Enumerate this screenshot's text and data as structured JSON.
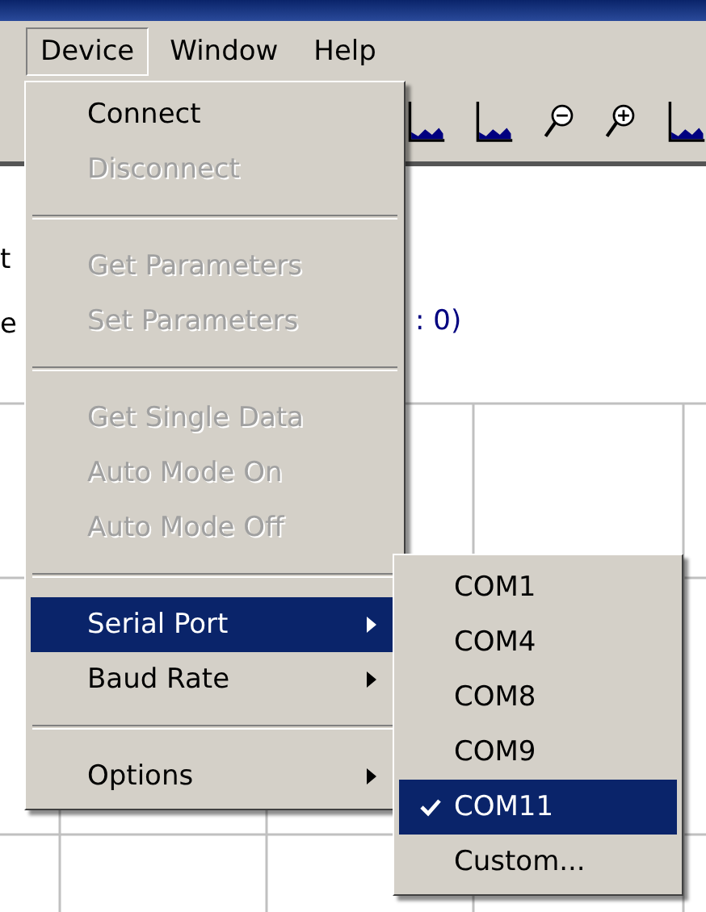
{
  "menubar": [
    {
      "label": "Device",
      "selected": true
    },
    {
      "label": "Window",
      "selected": false
    },
    {
      "label": "Help",
      "selected": false
    }
  ],
  "content": {
    "fragments": [
      "t",
      "e",
      ": 0)"
    ]
  },
  "menu": {
    "items": [
      {
        "kind": "item",
        "label": "Connect",
        "disabled": false,
        "selected": false
      },
      {
        "kind": "item",
        "label": "Disconnect",
        "disabled": true,
        "selected": false
      },
      {
        "kind": "separator"
      },
      {
        "kind": "item",
        "label": "Get Parameters",
        "disabled": true,
        "selected": false
      },
      {
        "kind": "item",
        "label": "Set Parameters",
        "disabled": true,
        "selected": false
      },
      {
        "kind": "separator"
      },
      {
        "kind": "item",
        "label": "Get Single Data",
        "disabled": true,
        "selected": false
      },
      {
        "kind": "item",
        "label": "Auto Mode On",
        "disabled": true,
        "selected": false
      },
      {
        "kind": "item",
        "label": "Auto Mode Off",
        "disabled": true,
        "selected": false
      },
      {
        "kind": "separator"
      },
      {
        "kind": "submenu",
        "label": "Serial Port",
        "disabled": false,
        "selected": true
      },
      {
        "kind": "submenu",
        "label": "Baud Rate",
        "disabled": false,
        "selected": false
      },
      {
        "kind": "separator"
      },
      {
        "kind": "submenu",
        "label": "Options",
        "disabled": false,
        "selected": false
      }
    ]
  },
  "submenu": {
    "items": [
      {
        "label": "COM1",
        "checked": false,
        "selected": false
      },
      {
        "label": "COM4",
        "checked": false,
        "selected": false
      },
      {
        "label": "COM8",
        "checked": false,
        "selected": false
      },
      {
        "label": "COM9",
        "checked": false,
        "selected": false
      },
      {
        "label": "COM11",
        "checked": true,
        "selected": true
      },
      {
        "label": "Custom...",
        "checked": false,
        "selected": false
      }
    ]
  }
}
